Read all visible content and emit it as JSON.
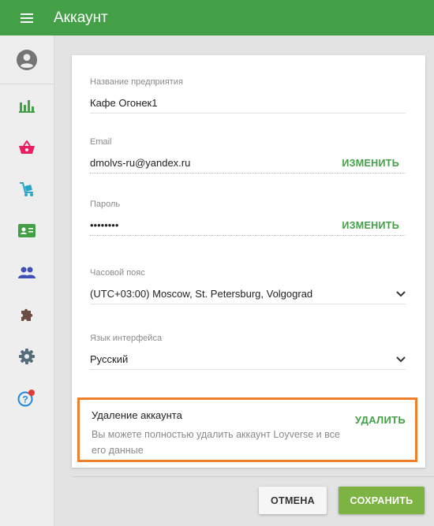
{
  "header": {
    "title": "Аккаунт"
  },
  "sidebar": {
    "items": [
      {
        "name": "account",
        "icon": "account-circle-icon",
        "color": "#757575"
      },
      {
        "name": "reports",
        "icon": "bar-chart-icon",
        "color": "#43a047"
      },
      {
        "name": "items",
        "icon": "basket-icon",
        "color": "#e91e63"
      },
      {
        "name": "inventory",
        "icon": "cart-icon",
        "color": "#26a7c9"
      },
      {
        "name": "employees",
        "icon": "id-card-icon",
        "color": "#43a047"
      },
      {
        "name": "customers",
        "icon": "people-icon",
        "color": "#3f51b5"
      },
      {
        "name": "integrations",
        "icon": "puzzle-icon",
        "color": "#6d4c41"
      },
      {
        "name": "settings",
        "icon": "gear-icon",
        "color": "#546e7a"
      },
      {
        "name": "help",
        "icon": "help-icon",
        "color": "#1e88e5"
      }
    ]
  },
  "form": {
    "business_name": {
      "label": "Название предприятия",
      "value": "Кафе Огонек1"
    },
    "email": {
      "label": "Email",
      "value": "dmolvs-ru@yandex.ru",
      "action": "ИЗМЕНИТЬ"
    },
    "password": {
      "label": "Пароль",
      "value": "••••••••",
      "action": "ИЗМЕНИТЬ"
    },
    "timezone": {
      "label": "Часовой пояс",
      "value": "(UTC+03:00) Moscow, St. Petersburg, Volgograd"
    },
    "language": {
      "label": "Язык интерфейса",
      "value": "Русский"
    }
  },
  "delete_account": {
    "title": "Удаление аккаунта",
    "description": "Вы можете полностью удалить аккаунт Loyverse и все его данные",
    "action": "УДАЛИТЬ"
  },
  "footer": {
    "cancel_label": "ОТМЕНА",
    "save_label": "СОХРАНИТЬ"
  },
  "colors": {
    "appbar": "#43a047",
    "accent": "#43a047",
    "save": "#7cb342",
    "highlight": "#ef7f2a"
  }
}
